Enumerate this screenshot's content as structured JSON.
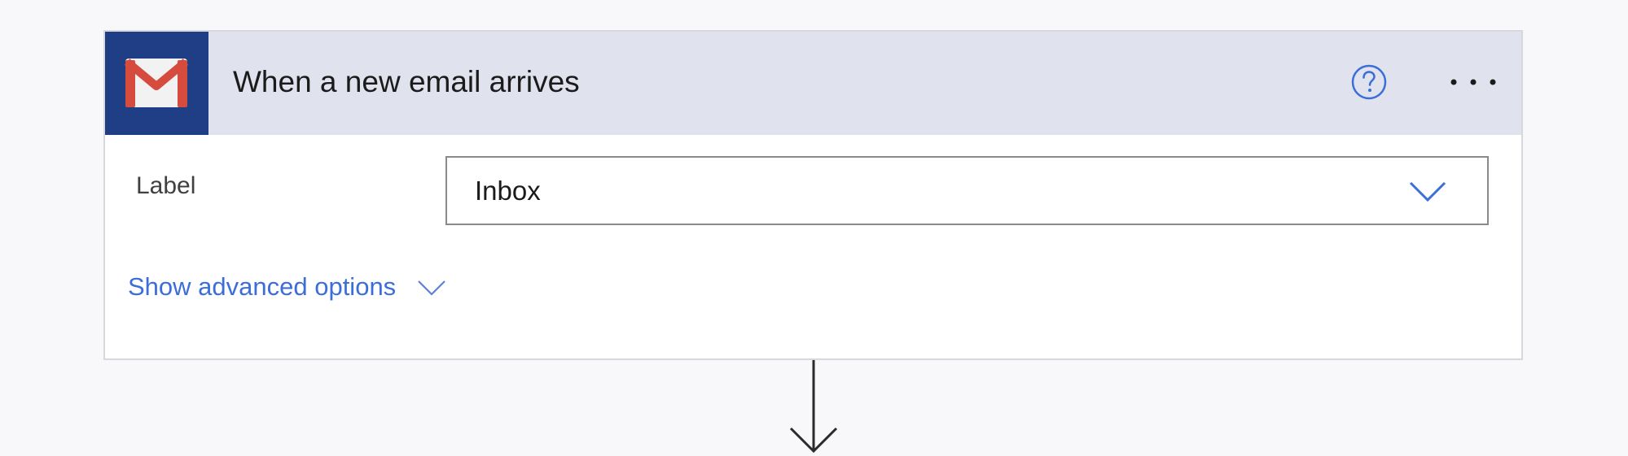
{
  "trigger": {
    "title": "When a new email arrives",
    "connector_icon": "gmail-icon",
    "help_icon": "help-circle-icon",
    "more_icon": "more-options-icon"
  },
  "fields": {
    "label": {
      "name": "Label",
      "value": "Inbox",
      "icon": "chevron-down-icon"
    }
  },
  "advanced": {
    "label": "Show advanced options",
    "icon": "chevron-down-icon"
  },
  "connector_arrow": {
    "icon": "arrow-down-icon"
  },
  "colors": {
    "header_bg": "#e0e2ee",
    "icon_bg": "#1f3e86",
    "accent": "#3b6ed9",
    "gmail_red": "#d54b3d"
  }
}
